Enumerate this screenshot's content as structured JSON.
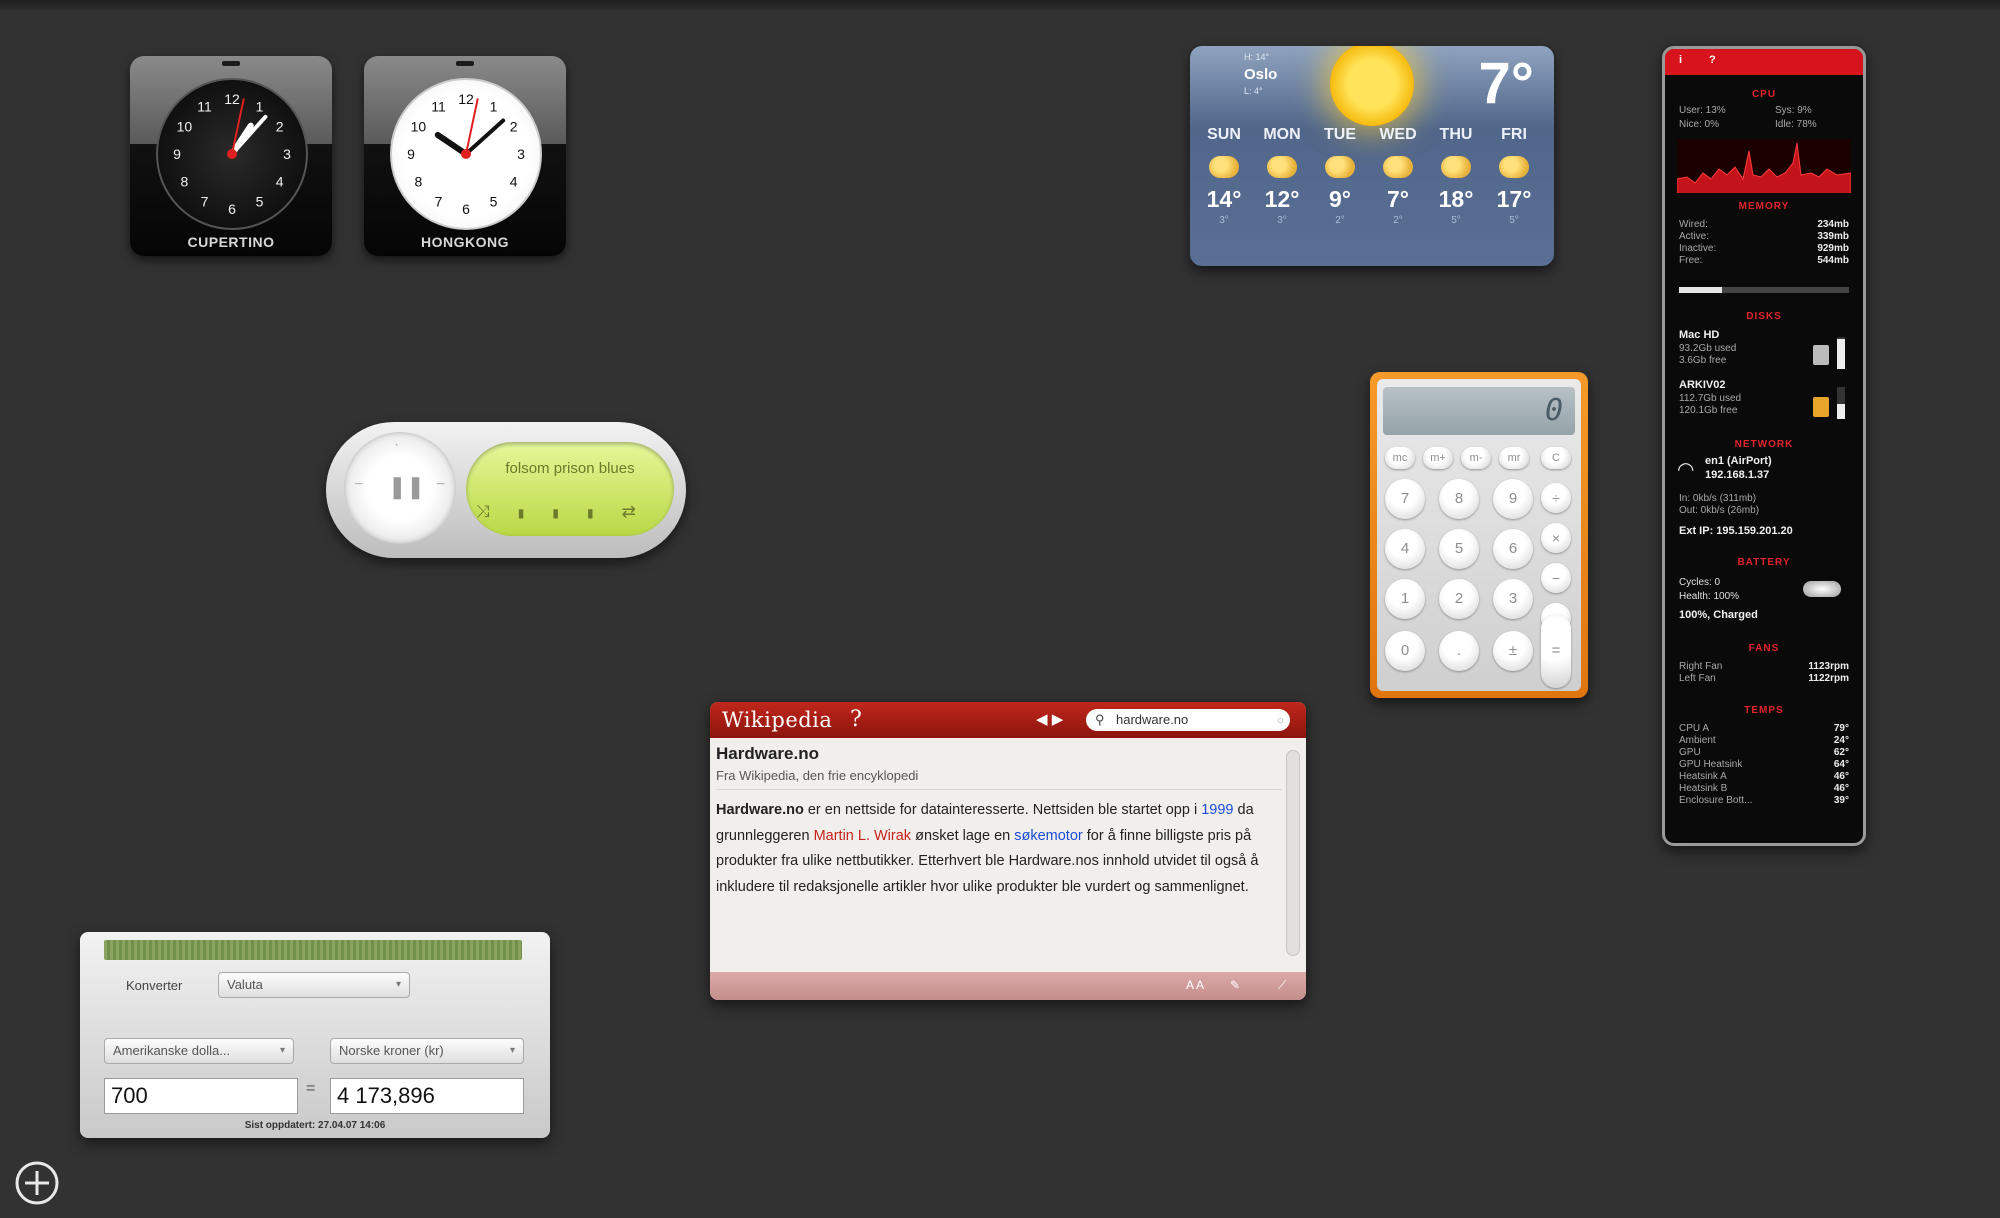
{
  "clocks": [
    {
      "city": "CUPERTINO",
      "theme": "dark",
      "hour": 1,
      "minute": 7,
      "second": 2
    },
    {
      "city": "HONGKONG",
      "theme": "light",
      "hour": 10,
      "minute": 8,
      "second": 2
    }
  ],
  "music": {
    "track": "folsom prison blues",
    "icons": [
      "pause-icon",
      "shuffle-icon",
      "equalizer-icon",
      "repeat-icon"
    ],
    "accent": "#c8e05a"
  },
  "weather": {
    "hilo": "H: 14°",
    "city": "Oslo",
    "hilo2": "L: 4°",
    "temp": "7°",
    "days": [
      {
        "name": "SUN",
        "temp": "14°",
        "low": "3°"
      },
      {
        "name": "MON",
        "temp": "12°",
        "low": "3°"
      },
      {
        "name": "TUE",
        "temp": "9°",
        "low": "2°"
      },
      {
        "name": "WED",
        "temp": "7°",
        "low": "2°"
      },
      {
        "name": "THU",
        "temp": "18°",
        "low": "5°"
      },
      {
        "name": "FRI",
        "temp": "17°",
        "low": "5°"
      }
    ]
  },
  "calculator": {
    "display": "0",
    "memory_keys": [
      "mc",
      "m+",
      "m-",
      "mr"
    ],
    "clear_key": "C",
    "ops": [
      "÷",
      "×",
      "−",
      "+"
    ],
    "equals": "=",
    "digits": [
      "7",
      "8",
      "9",
      "4",
      "5",
      "6",
      "1",
      "2",
      "3",
      "0",
      ".",
      "±"
    ],
    "accent": "#f08a1c"
  },
  "istat": {
    "header_left": "i",
    "header_right": "?",
    "cpu": {
      "title": "CPU",
      "user": "User: 13%",
      "sys": "Sys: 9%",
      "nice": "Nice: 0%",
      "idle": "Idle: 78%"
    },
    "memory": {
      "title": "MEMORY",
      "labels": [
        "Wired:",
        "Active:",
        "Inactive:",
        "Free:"
      ],
      "values": [
        "234mb",
        "339mb",
        "929mb",
        "544mb"
      ],
      "usage": 0.25
    },
    "disks": {
      "title": "DISKS",
      "items": [
        {
          "name": "Mac HD",
          "line1": "93.2Gb used",
          "line2": "3.6Gb free",
          "usage": 0.95
        },
        {
          "name": "ARKIV02",
          "line1": "112.7Gb used",
          "line2": "120.1Gb free",
          "usage": 0.48
        }
      ]
    },
    "network": {
      "title": "NETWORK",
      "iface": "en1 (AirPort)",
      "ip": "192.168.1.37",
      "in": "In: 0kb/s (311mb)",
      "out": "Out: 0kb/s (26mb)",
      "ext": "Ext IP: 195.159.201.20"
    },
    "battery": {
      "title": "BATTERY",
      "cycles": "Cycles: 0",
      "health": "Health: 100%",
      "status": "100%, Charged"
    },
    "fans": {
      "title": "FANS",
      "labels": [
        "Right Fan",
        "Left Fan"
      ],
      "values": [
        "1123rpm",
        "1122rpm"
      ]
    },
    "temps": {
      "title": "TEMPS",
      "labels": [
        "CPU A",
        "Ambient",
        "GPU",
        "GPU Heatsink",
        "Heatsink A",
        "Heatsink B",
        "Enclosure Bott..."
      ],
      "values": [
        "79°",
        "24°",
        "62°",
        "64°",
        "46°",
        "46°",
        "39°"
      ]
    },
    "accent": "#d7141c"
  },
  "wikipedia": {
    "logo": "Wikipedia",
    "help": "?",
    "nav": "◀ ▶",
    "search_value": "hardware.no",
    "title": "Hardware.no",
    "subtitle": "Fra Wikipedia, den frie encyklopedi",
    "p_bold": "Hardware.no",
    "p1": " er en nettside for datainteresserte. Nettsiden ble startet opp i ",
    "link_year": "1999",
    "p2": " da grunnleggeren ",
    "link_person": "Martin L. Wirak",
    "p3": " ønsket lage en ",
    "link_search": "søkemotor",
    "p4": " for å finne billigste pris på produkter fra ulike nettbutikker. Etterhvert ble Hardware.nos innhold utvidet til også å inkludere til redaksjonelle artikler hvor ulike produkter ble vurdert og sammenlignet.",
    "foot_font": "A A",
    "foot_edit": "✎",
    "accent": "#b01e15"
  },
  "converter": {
    "convert_label": "Konverter",
    "category": "Valuta",
    "from_unit": "Amerikanske dolla...",
    "to_unit": "Norske kroner (kr)",
    "from_value": "700",
    "equals": "=",
    "to_value": "4 173,896",
    "updated": "Sist oppdatert: 27.04.07 14:06"
  },
  "dashboard": {
    "add_widget": "add-widget-icon"
  }
}
